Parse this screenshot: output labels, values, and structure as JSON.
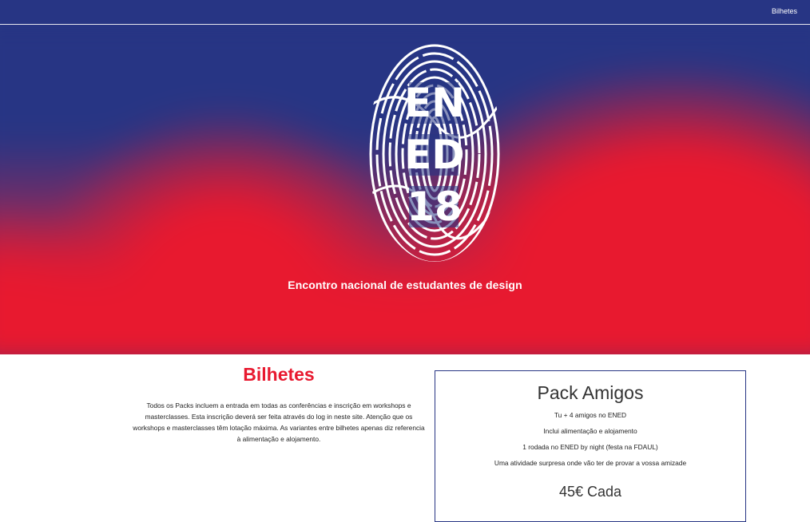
{
  "nav": {
    "link_label": "Bilhetes"
  },
  "hero": {
    "logo_text": [
      "EN",
      "ED",
      "18"
    ],
    "tagline": "Encontro nacional de estudantes de design"
  },
  "tickets": {
    "title": "Bilhetes",
    "description": "Todos os Packs incluem a entrada em todas as conferências e inscrição em workshops e masterclasses. Esta inscrição deverá ser feita através do log in neste site. Atenção que os workshops e masterclasses têm lotação máxima. As variantes entre bilhetes apenas diz referencia à alimentação e alojamento."
  },
  "pack": {
    "title": "Pack Amigos",
    "features": [
      "Tu + 4 amigos no ENED",
      "Inclui alimentação e alojamento",
      "1 rodada no ENED by night (festa na FDAUL)",
      "Uma atividade surpresa onde vão ter de provar a vossa amizade"
    ],
    "price": "45€ Cada"
  },
  "colors": {
    "brand_blue": "#273584",
    "brand_red": "#e8192f"
  }
}
